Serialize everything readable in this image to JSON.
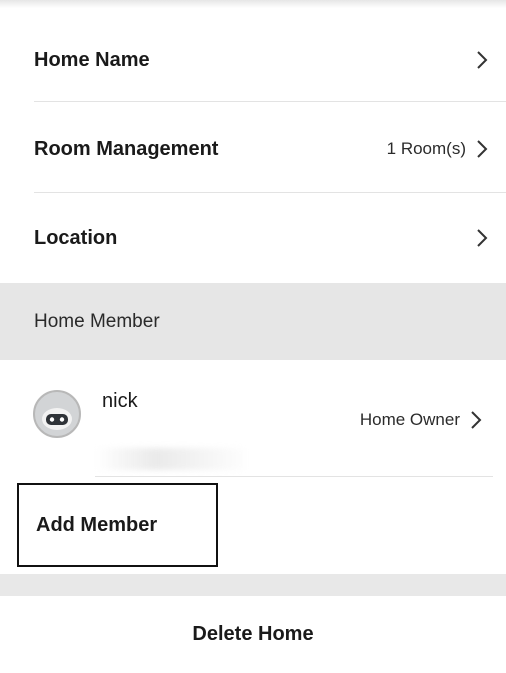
{
  "settings": {
    "items": [
      {
        "label": "Home Name",
        "value": ""
      },
      {
        "label": "Room Management",
        "value": "1 Room(s)"
      },
      {
        "label": "Location",
        "value": ""
      }
    ]
  },
  "members_section": {
    "header": "Home Member",
    "members": [
      {
        "name": "nick",
        "role": "Home Owner",
        "avatar_icon": "robot-avatar-icon"
      }
    ],
    "add_label": "Add Member"
  },
  "actions": {
    "delete_label": "Delete Home"
  },
  "colors": {
    "section_bg": "#e6e6e6",
    "text": "#1a1a1a",
    "highlight_border": "#111111"
  }
}
